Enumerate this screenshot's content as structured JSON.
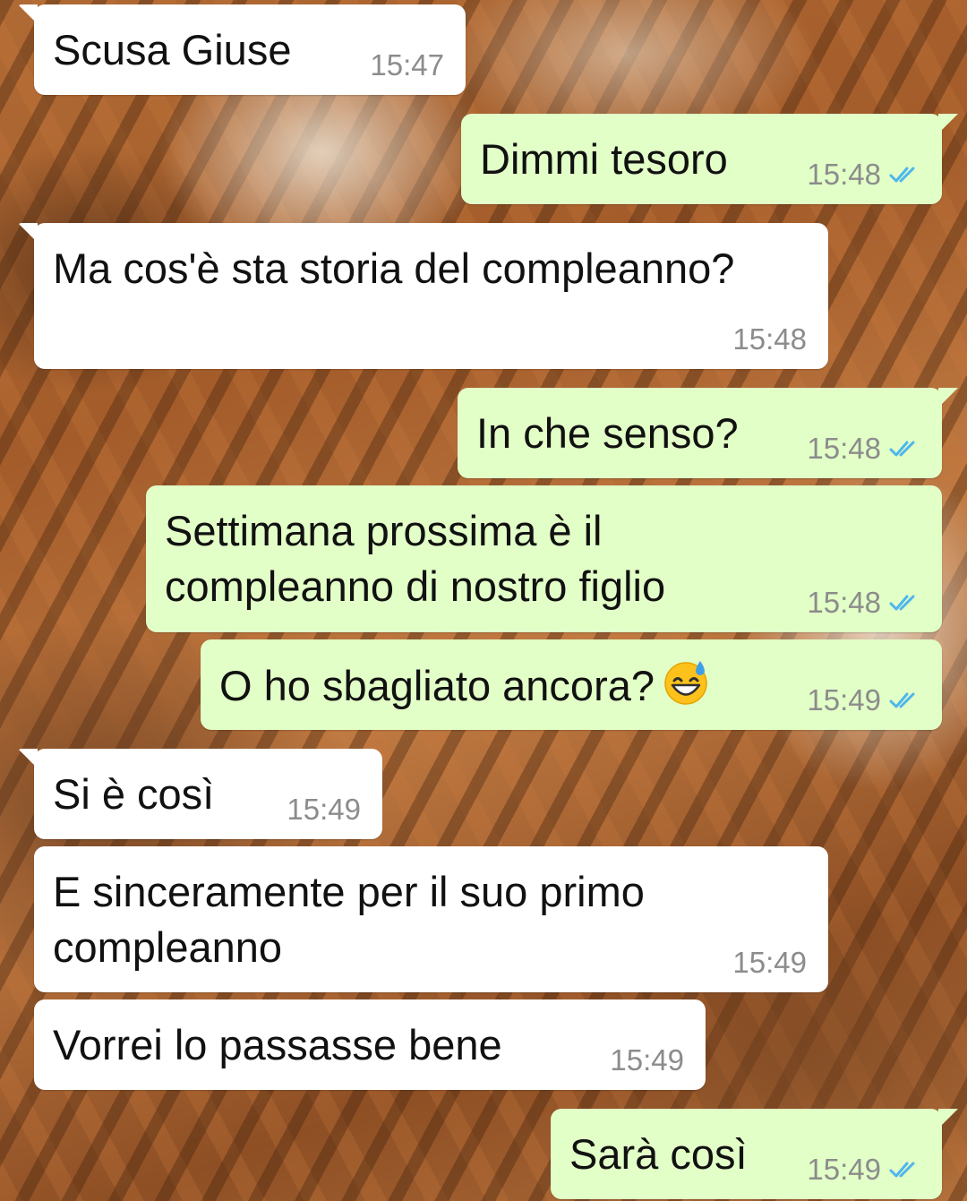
{
  "chat": {
    "messages": [
      {
        "direction": "incoming",
        "text": "Scusa Giuse",
        "time": "15:47"
      },
      {
        "direction": "outgoing",
        "text": "Dimmi tesoro",
        "time": "15:48",
        "status_icon": "double-check-read-icon"
      },
      {
        "direction": "incoming",
        "text": "Ma cos'è sta storia del compleanno?",
        "time": "15:48"
      },
      {
        "direction": "outgoing",
        "text": "In che senso?",
        "time": "15:48",
        "status_icon": "double-check-read-icon"
      },
      {
        "direction": "outgoing",
        "line1": "Settimana prossima è il",
        "line2": "compleanno di nostro figlio",
        "time": "15:48",
        "status_icon": "double-check-read-icon"
      },
      {
        "direction": "outgoing",
        "text": "O ho sbagliato ancora?",
        "emoji": "grinning-sweat-emoji",
        "time": "15:49",
        "status_icon": "double-check-read-icon"
      },
      {
        "direction": "incoming",
        "text": "Si è così",
        "time": "15:49"
      },
      {
        "direction": "incoming",
        "line1": "E sinceramente per il suo primo",
        "line2": "compleanno",
        "time": "15:49"
      },
      {
        "direction": "incoming",
        "text": "Vorrei lo passasse bene",
        "time": "15:49"
      },
      {
        "direction": "outgoing",
        "text": "Sarà così",
        "time": "15:49",
        "status_icon": "double-check-read-icon"
      }
    ]
  },
  "colors": {
    "incoming_bubble": "#ffffff",
    "outgoing_bubble": "#e2ffc7",
    "read_check": "#4fb6ec",
    "timestamp": "#8c8c8c"
  }
}
